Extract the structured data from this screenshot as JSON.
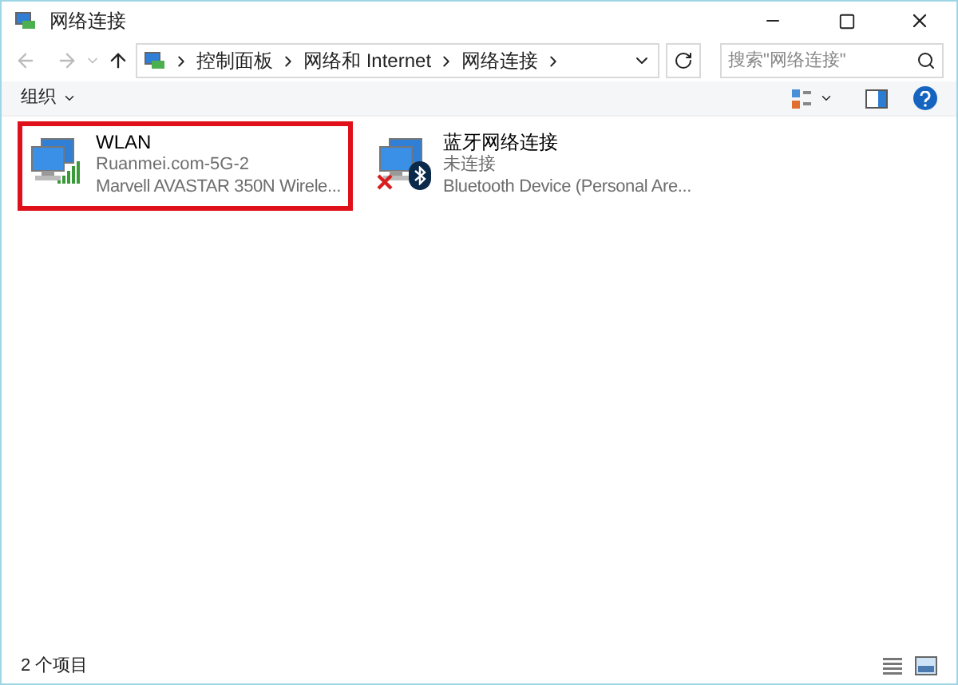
{
  "window": {
    "title": "网络连接"
  },
  "address_bar": {
    "path": [
      "控制面板",
      "网络和 Internet",
      "网络连接"
    ]
  },
  "search": {
    "placeholder": "搜索\"网络连接\""
  },
  "toolbar": {
    "organize": "组织"
  },
  "connections": [
    {
      "kind": "wifi",
      "name": "WLAN",
      "status": "Ruanmei.com-5G-2",
      "device": "Marvell AVASTAR 350N Wirele...",
      "highlighted": true,
      "connected": true
    },
    {
      "kind": "bluetooth",
      "name": "蓝牙网络连接",
      "status": "未连接",
      "device": "Bluetooth Device (Personal Are...",
      "highlighted": false,
      "connected": false
    }
  ],
  "status_bar": {
    "count": "2 个项目"
  }
}
